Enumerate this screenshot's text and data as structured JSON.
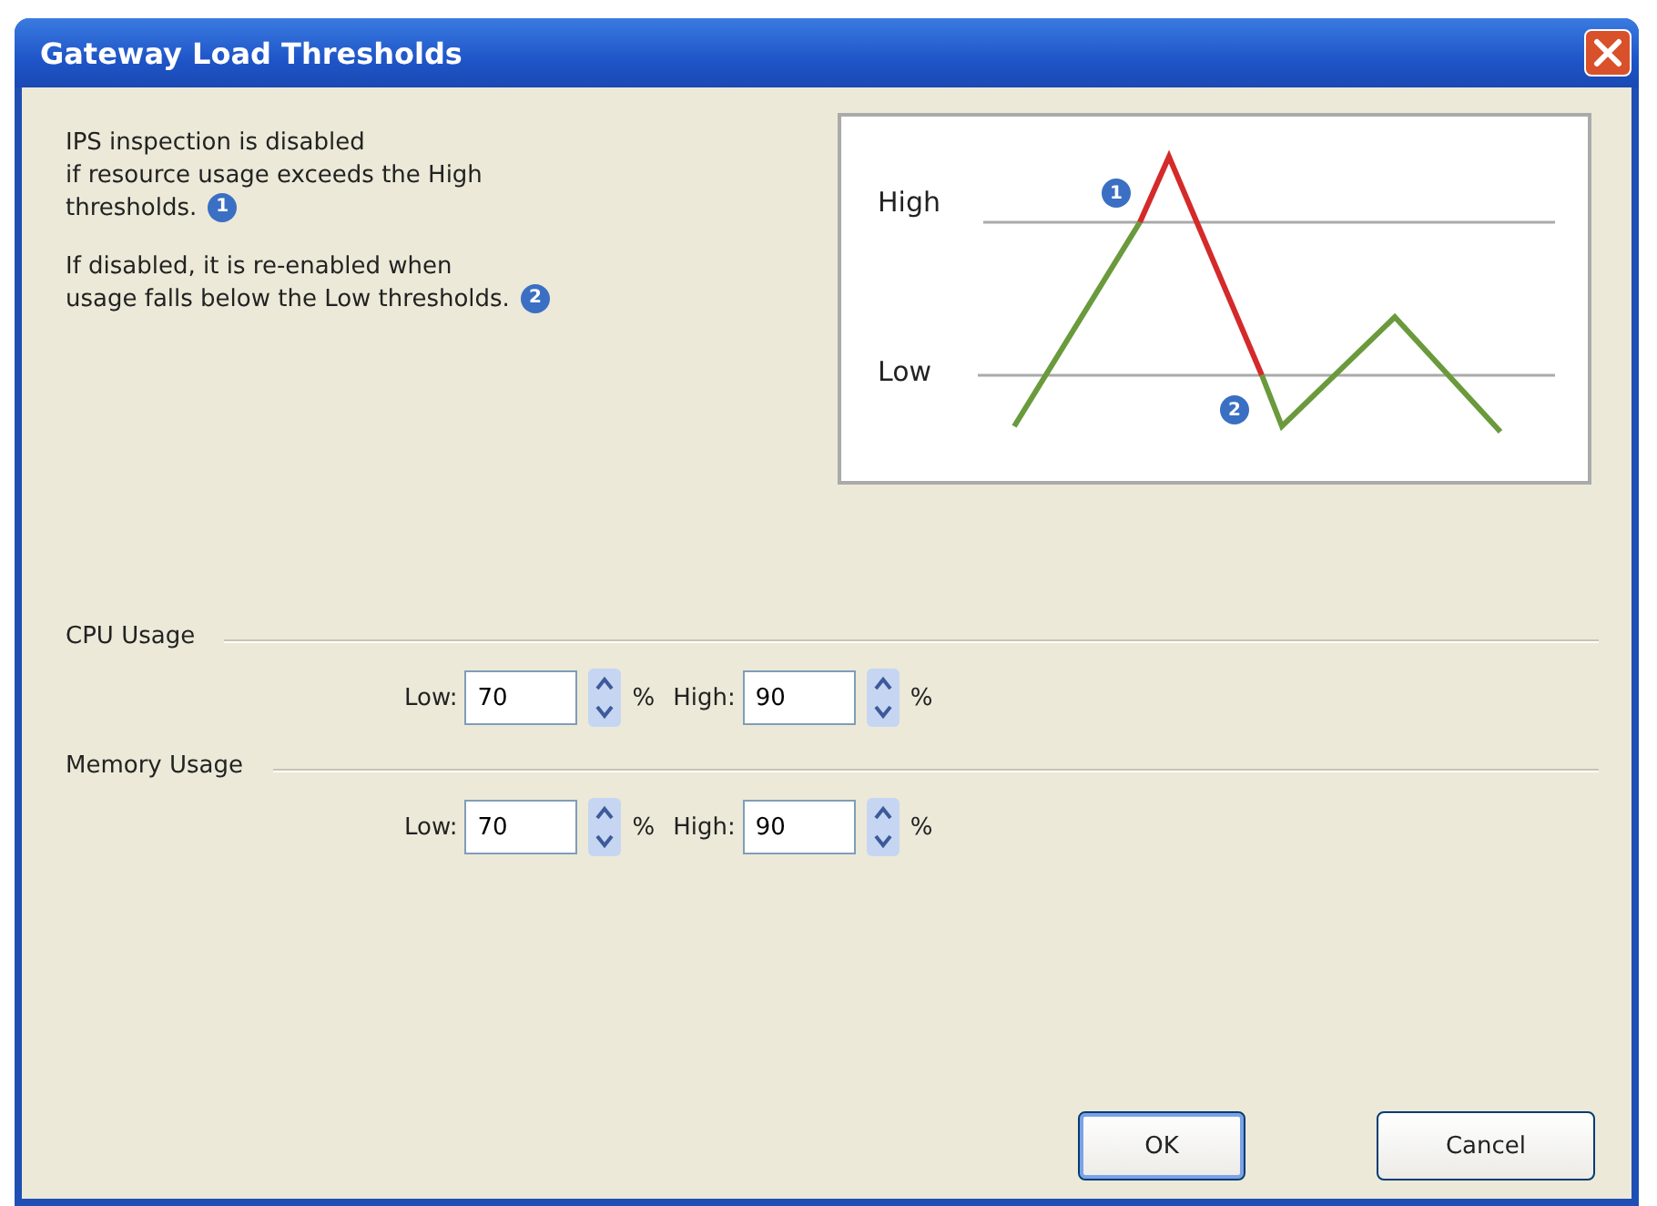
{
  "window": {
    "title": "Gateway Load Thresholds"
  },
  "notes": [
    {
      "text": "IPS inspection is disabled\nif resource usage exceeds the High\nthresholds.",
      "badge": "1"
    },
    {
      "text": "If disabled, it is re-enabled when\nusage falls below the Low thresholds.",
      "badge": "2"
    }
  ],
  "diagram": {
    "high_label": "High",
    "low_label": "Low",
    "badges": [
      "1",
      "2"
    ]
  },
  "groups": [
    {
      "label": "CPU Usage",
      "fields": [
        {
          "label": "Low:",
          "value": "70",
          "unit": "%"
        },
        {
          "label": "High:",
          "value": "90",
          "unit": "%"
        }
      ]
    },
    {
      "label": "Memory Usage",
      "fields": [
        {
          "label": "Low:",
          "value": "70",
          "unit": "%"
        },
        {
          "label": "High:",
          "value": "90",
          "unit": "%"
        }
      ]
    }
  ],
  "buttons": [
    {
      "label": "OK",
      "default": true
    },
    {
      "label": "Cancel",
      "default": false
    }
  ]
}
